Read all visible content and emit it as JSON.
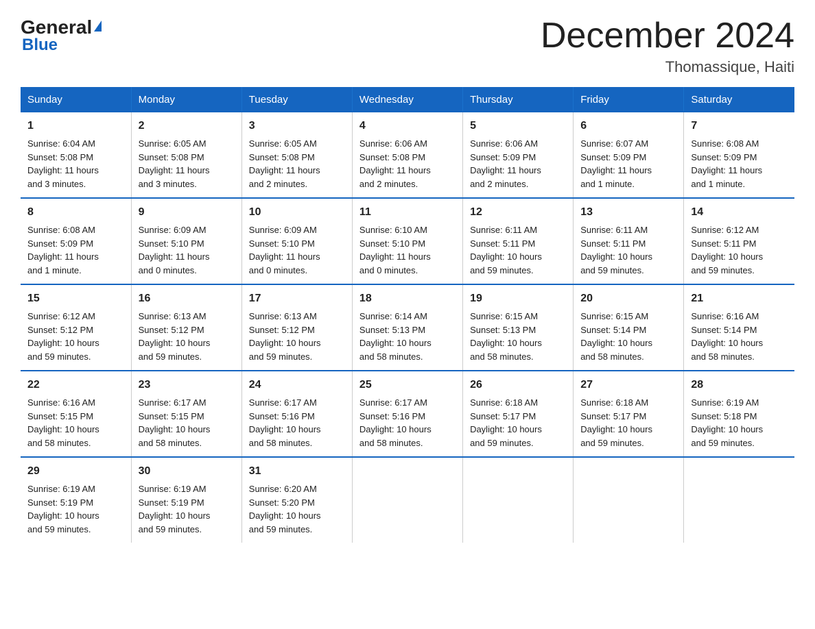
{
  "header": {
    "logo_line1": "General",
    "logo_line2": "Blue",
    "main_title": "December 2024",
    "subtitle": "Thomassique, Haiti"
  },
  "days_of_week": [
    "Sunday",
    "Monday",
    "Tuesday",
    "Wednesday",
    "Thursday",
    "Friday",
    "Saturday"
  ],
  "weeks": [
    [
      {
        "day": "1",
        "info": "Sunrise: 6:04 AM\nSunset: 5:08 PM\nDaylight: 11 hours\nand 3 minutes."
      },
      {
        "day": "2",
        "info": "Sunrise: 6:05 AM\nSunset: 5:08 PM\nDaylight: 11 hours\nand 3 minutes."
      },
      {
        "day": "3",
        "info": "Sunrise: 6:05 AM\nSunset: 5:08 PM\nDaylight: 11 hours\nand 2 minutes."
      },
      {
        "day": "4",
        "info": "Sunrise: 6:06 AM\nSunset: 5:08 PM\nDaylight: 11 hours\nand 2 minutes."
      },
      {
        "day": "5",
        "info": "Sunrise: 6:06 AM\nSunset: 5:09 PM\nDaylight: 11 hours\nand 2 minutes."
      },
      {
        "day": "6",
        "info": "Sunrise: 6:07 AM\nSunset: 5:09 PM\nDaylight: 11 hours\nand 1 minute."
      },
      {
        "day": "7",
        "info": "Sunrise: 6:08 AM\nSunset: 5:09 PM\nDaylight: 11 hours\nand 1 minute."
      }
    ],
    [
      {
        "day": "8",
        "info": "Sunrise: 6:08 AM\nSunset: 5:09 PM\nDaylight: 11 hours\nand 1 minute."
      },
      {
        "day": "9",
        "info": "Sunrise: 6:09 AM\nSunset: 5:10 PM\nDaylight: 11 hours\nand 0 minutes."
      },
      {
        "day": "10",
        "info": "Sunrise: 6:09 AM\nSunset: 5:10 PM\nDaylight: 11 hours\nand 0 minutes."
      },
      {
        "day": "11",
        "info": "Sunrise: 6:10 AM\nSunset: 5:10 PM\nDaylight: 11 hours\nand 0 minutes."
      },
      {
        "day": "12",
        "info": "Sunrise: 6:11 AM\nSunset: 5:11 PM\nDaylight: 10 hours\nand 59 minutes."
      },
      {
        "day": "13",
        "info": "Sunrise: 6:11 AM\nSunset: 5:11 PM\nDaylight: 10 hours\nand 59 minutes."
      },
      {
        "day": "14",
        "info": "Sunrise: 6:12 AM\nSunset: 5:11 PM\nDaylight: 10 hours\nand 59 minutes."
      }
    ],
    [
      {
        "day": "15",
        "info": "Sunrise: 6:12 AM\nSunset: 5:12 PM\nDaylight: 10 hours\nand 59 minutes."
      },
      {
        "day": "16",
        "info": "Sunrise: 6:13 AM\nSunset: 5:12 PM\nDaylight: 10 hours\nand 59 minutes."
      },
      {
        "day": "17",
        "info": "Sunrise: 6:13 AM\nSunset: 5:12 PM\nDaylight: 10 hours\nand 59 minutes."
      },
      {
        "day": "18",
        "info": "Sunrise: 6:14 AM\nSunset: 5:13 PM\nDaylight: 10 hours\nand 58 minutes."
      },
      {
        "day": "19",
        "info": "Sunrise: 6:15 AM\nSunset: 5:13 PM\nDaylight: 10 hours\nand 58 minutes."
      },
      {
        "day": "20",
        "info": "Sunrise: 6:15 AM\nSunset: 5:14 PM\nDaylight: 10 hours\nand 58 minutes."
      },
      {
        "day": "21",
        "info": "Sunrise: 6:16 AM\nSunset: 5:14 PM\nDaylight: 10 hours\nand 58 minutes."
      }
    ],
    [
      {
        "day": "22",
        "info": "Sunrise: 6:16 AM\nSunset: 5:15 PM\nDaylight: 10 hours\nand 58 minutes."
      },
      {
        "day": "23",
        "info": "Sunrise: 6:17 AM\nSunset: 5:15 PM\nDaylight: 10 hours\nand 58 minutes."
      },
      {
        "day": "24",
        "info": "Sunrise: 6:17 AM\nSunset: 5:16 PM\nDaylight: 10 hours\nand 58 minutes."
      },
      {
        "day": "25",
        "info": "Sunrise: 6:17 AM\nSunset: 5:16 PM\nDaylight: 10 hours\nand 58 minutes."
      },
      {
        "day": "26",
        "info": "Sunrise: 6:18 AM\nSunset: 5:17 PM\nDaylight: 10 hours\nand 59 minutes."
      },
      {
        "day": "27",
        "info": "Sunrise: 6:18 AM\nSunset: 5:17 PM\nDaylight: 10 hours\nand 59 minutes."
      },
      {
        "day": "28",
        "info": "Sunrise: 6:19 AM\nSunset: 5:18 PM\nDaylight: 10 hours\nand 59 minutes."
      }
    ],
    [
      {
        "day": "29",
        "info": "Sunrise: 6:19 AM\nSunset: 5:19 PM\nDaylight: 10 hours\nand 59 minutes."
      },
      {
        "day": "30",
        "info": "Sunrise: 6:19 AM\nSunset: 5:19 PM\nDaylight: 10 hours\nand 59 minutes."
      },
      {
        "day": "31",
        "info": "Sunrise: 6:20 AM\nSunset: 5:20 PM\nDaylight: 10 hours\nand 59 minutes."
      },
      {
        "day": "",
        "info": ""
      },
      {
        "day": "",
        "info": ""
      },
      {
        "day": "",
        "info": ""
      },
      {
        "day": "",
        "info": ""
      }
    ]
  ]
}
